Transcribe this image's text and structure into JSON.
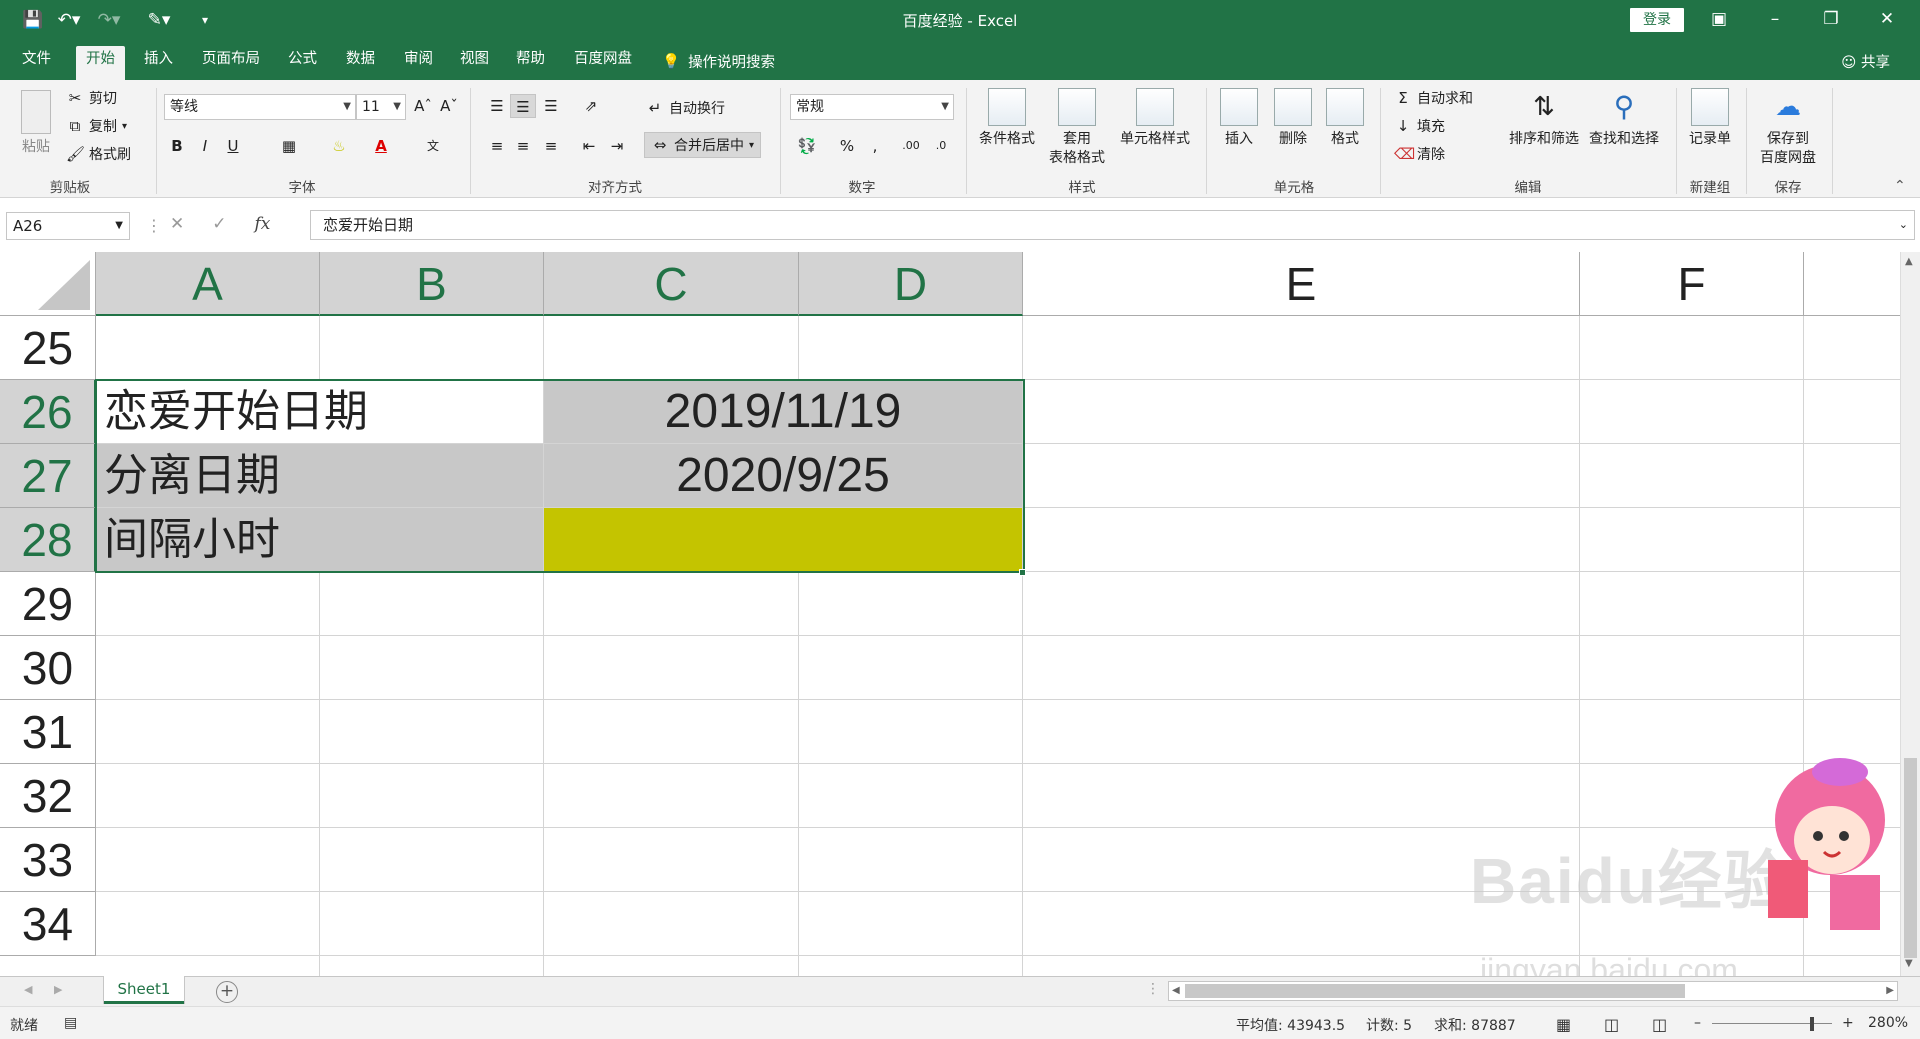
{
  "app": {
    "title": "百度经验 - Excel",
    "login": "登录"
  },
  "tabs": [
    "文件",
    "开始",
    "插入",
    "页面布局",
    "公式",
    "数据",
    "审阅",
    "视图",
    "帮助",
    "百度网盘"
  ],
  "active_tab": "开始",
  "tell_me": "操作说明搜索",
  "share": "共享",
  "ribbon": {
    "clipboard": {
      "paste": "粘贴",
      "cut": "剪切",
      "copy": "复制",
      "format_painter": "格式刷",
      "label": "剪贴板"
    },
    "font": {
      "name": "等线",
      "size": "11",
      "bold": "B",
      "italic": "I",
      "underline": "U",
      "label": "字体"
    },
    "alignment": {
      "wrap": "自动换行",
      "merge": "合并后居中",
      "label": "对齐方式"
    },
    "number": {
      "format": "常规",
      "label": "数字"
    },
    "styles": {
      "conditional": "条件格式",
      "table_a": "套用",
      "table_b": "表格格式",
      "cell_styles": "单元格样式",
      "label": "样式"
    },
    "cells": {
      "insert": "插入",
      "delete": "删除",
      "format": "格式",
      "label": "单元格"
    },
    "editing": {
      "autosum": "自动求和",
      "fill": "填充",
      "clear": "清除",
      "sort": "排序和筛选",
      "find": "查找和选择",
      "label": "编辑"
    },
    "newgroup": {
      "record": "记录单",
      "label": "新建组"
    },
    "save": {
      "save_a": "保存到",
      "save_b": "百度网盘",
      "label": "保存"
    }
  },
  "formula_bar": {
    "name_box": "A26",
    "content": "恋爱开始日期"
  },
  "columns": [
    "A",
    "B",
    "C",
    "D",
    "E",
    "F"
  ],
  "rows": [
    "25",
    "26",
    "27",
    "28",
    "29",
    "30",
    "31",
    "32",
    "33",
    "34"
  ],
  "cells": {
    "A26": "恋爱开始日期",
    "C26": "2019/11/19",
    "A27": "分离日期",
    "C27": "2020/9/25",
    "A28": "间隔小时",
    "C28": ""
  },
  "colors": {
    "accent": "#217346",
    "selected_fill": "#c8c8c8",
    "highlight_fill": "#c4c400"
  },
  "sheet_tab": "Sheet1",
  "status": {
    "ready": "就绪",
    "average": "平均值: 43943.5",
    "count": "计数: 5",
    "sum": "求和: 87887",
    "zoom": "280%"
  },
  "watermark": {
    "brand": "Baidu经验",
    "url": "jingyan.baidu.com"
  }
}
